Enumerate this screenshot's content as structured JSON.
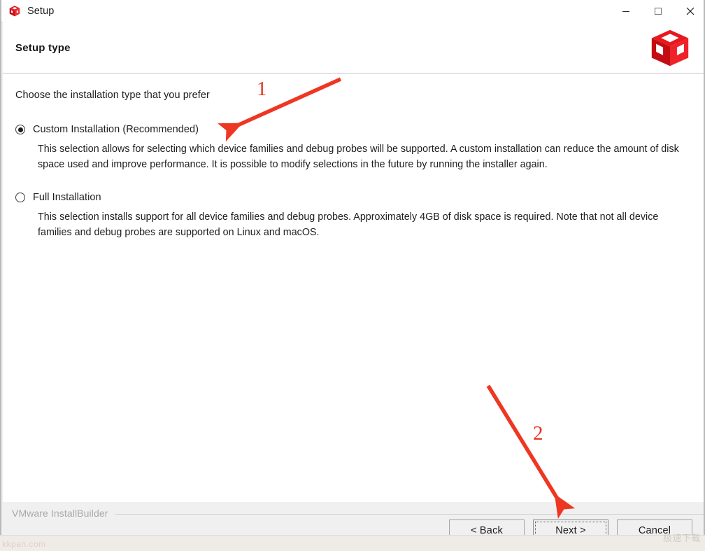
{
  "window": {
    "title": "Setup",
    "icon": "red-cube-icon",
    "controls": {
      "minimize": "minimize-icon",
      "maximize": "maximize-icon",
      "close": "close-icon"
    }
  },
  "header": {
    "page_title": "Setup type",
    "logo": "red-cube-logo"
  },
  "main": {
    "intro": "Choose the installation type that you prefer",
    "options": [
      {
        "label": "Custom Installation (Recommended)",
        "selected": true,
        "description": "This selection allows for selecting which device families and debug probes will be supported.  A custom installation can reduce the amount of disk space used and improve performance.  It is possible to modify selections in the future by running the installer again."
      },
      {
        "label": "Full Installation",
        "selected": false,
        "description": "This selection installs support for all device families and debug probes.  Approximately 4GB of disk space is required.  Note that not all device families and debug probes are supported on Linux and macOS."
      }
    ]
  },
  "footer": {
    "branding": "VMware InstallBuilder",
    "buttons": {
      "back": "< Back",
      "next": "Next >",
      "cancel": "Cancel"
    }
  },
  "annotations": {
    "arrow_1_number": "1",
    "arrow_2_number": "2",
    "color": "#e8361f"
  },
  "watermarks": {
    "left": "kkpan.com",
    "right": "极速下载"
  }
}
